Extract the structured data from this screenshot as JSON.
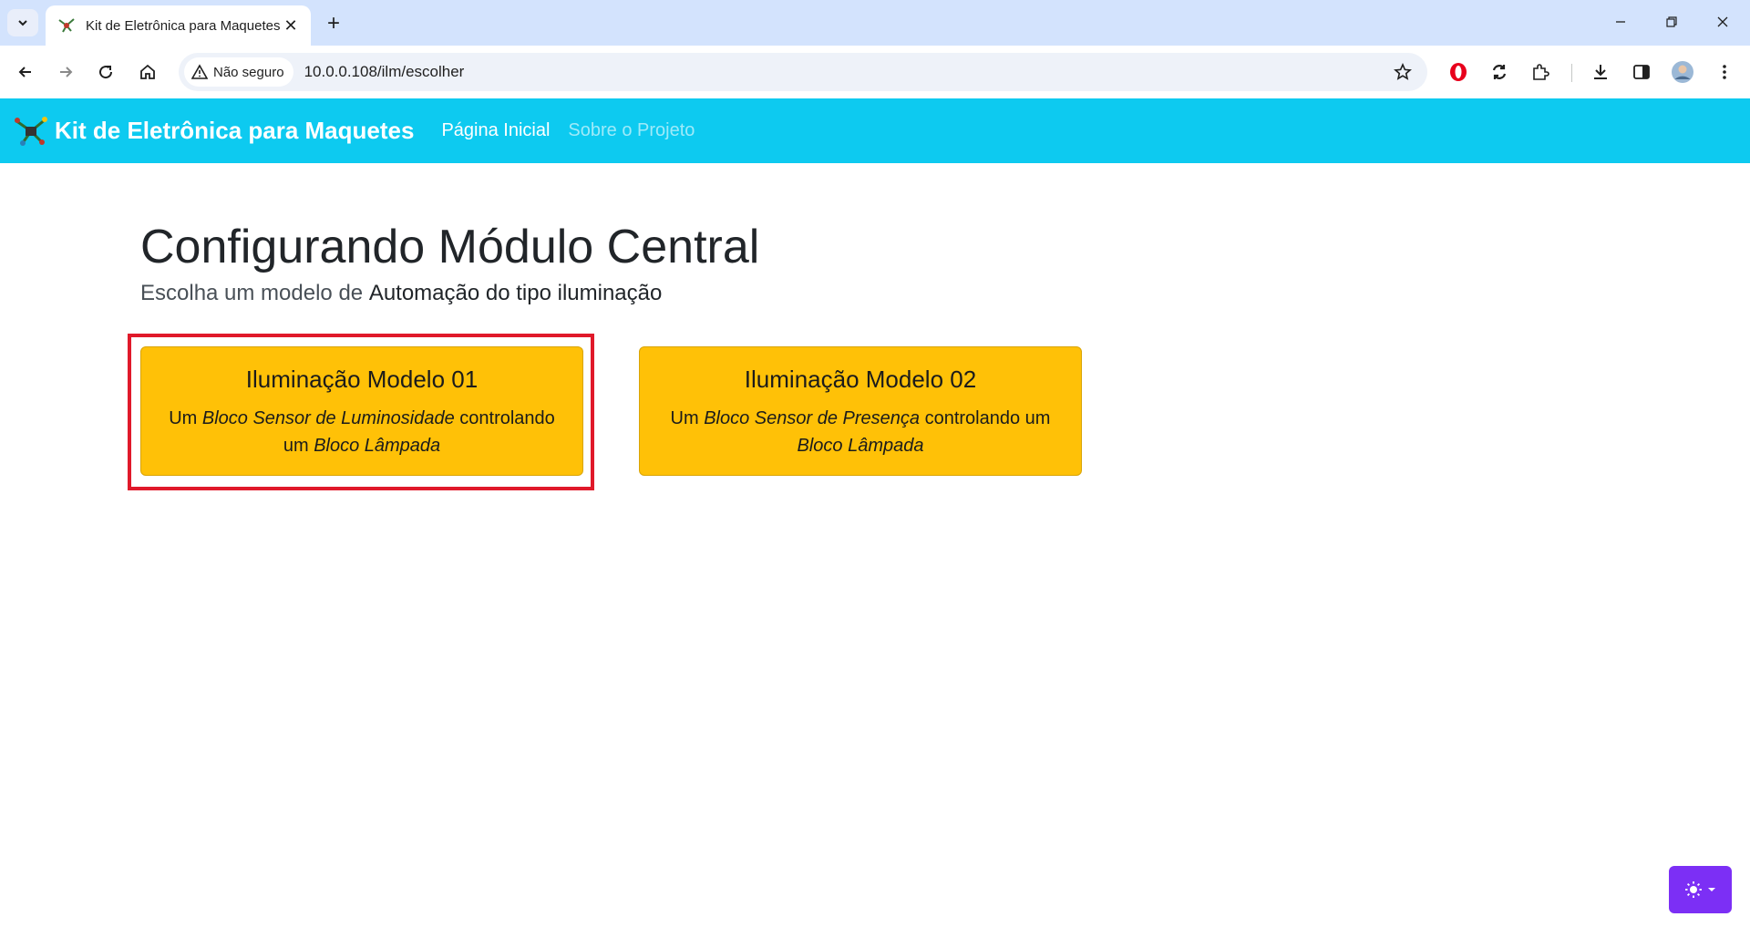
{
  "browser": {
    "tab": {
      "title": "Kit de Eletrônica para Maquetes"
    },
    "address": {
      "security_label": "Não seguro",
      "url": "10.0.0.108/ilm/escolher"
    }
  },
  "site": {
    "brand": "Kit de Eletrônica para Maquetes",
    "nav": [
      {
        "label": "Página Inicial",
        "active": true
      },
      {
        "label": "Sobre o Projeto",
        "active": false
      }
    ]
  },
  "page": {
    "title": "Configurando Módulo Central",
    "lead_prefix": "Escolha um modelo de",
    "lead_emphasis": "Automação do tipo iluminação"
  },
  "cards": [
    {
      "title": "Iluminação Modelo 01",
      "desc_part1": "Um",
      "desc_italic1": "Bloco Sensor de Luminosidade",
      "desc_part2": "controlando um",
      "desc_italic2": "Bloco Lâmpada",
      "highlighted": true
    },
    {
      "title": "Iluminação Modelo 02",
      "desc_part1": "Um",
      "desc_italic1": "Bloco Sensor de Presença",
      "desc_part2": "controlando um",
      "desc_italic2": "Bloco Lâmpada",
      "highlighted": false
    }
  ],
  "colors": {
    "navbar": "#0dcaf0",
    "card": "#ffc107",
    "highlight": "#e0192a",
    "theme_toggle": "#7c2ff5"
  },
  "icons": {
    "theme_toggle": "sun-icon"
  }
}
